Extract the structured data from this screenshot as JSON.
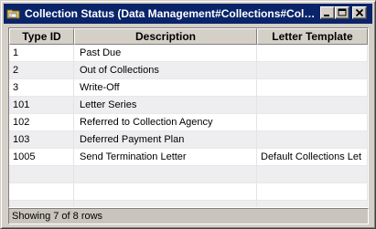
{
  "window": {
    "title": "Collection Status (Data Management#Collections#Collections Status)",
    "icon": "folder-icon"
  },
  "titlebar_buttons": {
    "minimize_icon": "minimize-icon",
    "maximize_icon": "maximize-icon",
    "close_icon": "close-icon"
  },
  "table": {
    "columns": [
      "Type ID",
      "Description",
      "Letter Template"
    ],
    "rows": [
      [
        "1",
        "Past Due",
        ""
      ],
      [
        "2",
        "Out of Collections",
        ""
      ],
      [
        "3",
        "Write-Off",
        ""
      ],
      [
        "101",
        "Letter Series",
        ""
      ],
      [
        "102",
        "Referred to Collection Agency",
        ""
      ],
      [
        "103",
        "Deferred Payment Plan",
        ""
      ],
      [
        "1005",
        "Send Termination Letter",
        "Default  Collections Let"
      ]
    ]
  },
  "status": {
    "text": "Showing 7 of 8 rows"
  },
  "colors": {
    "title_bar": "#0a246a",
    "window_face": "#d4d0c8",
    "alt_row": "#eeeef0"
  }
}
